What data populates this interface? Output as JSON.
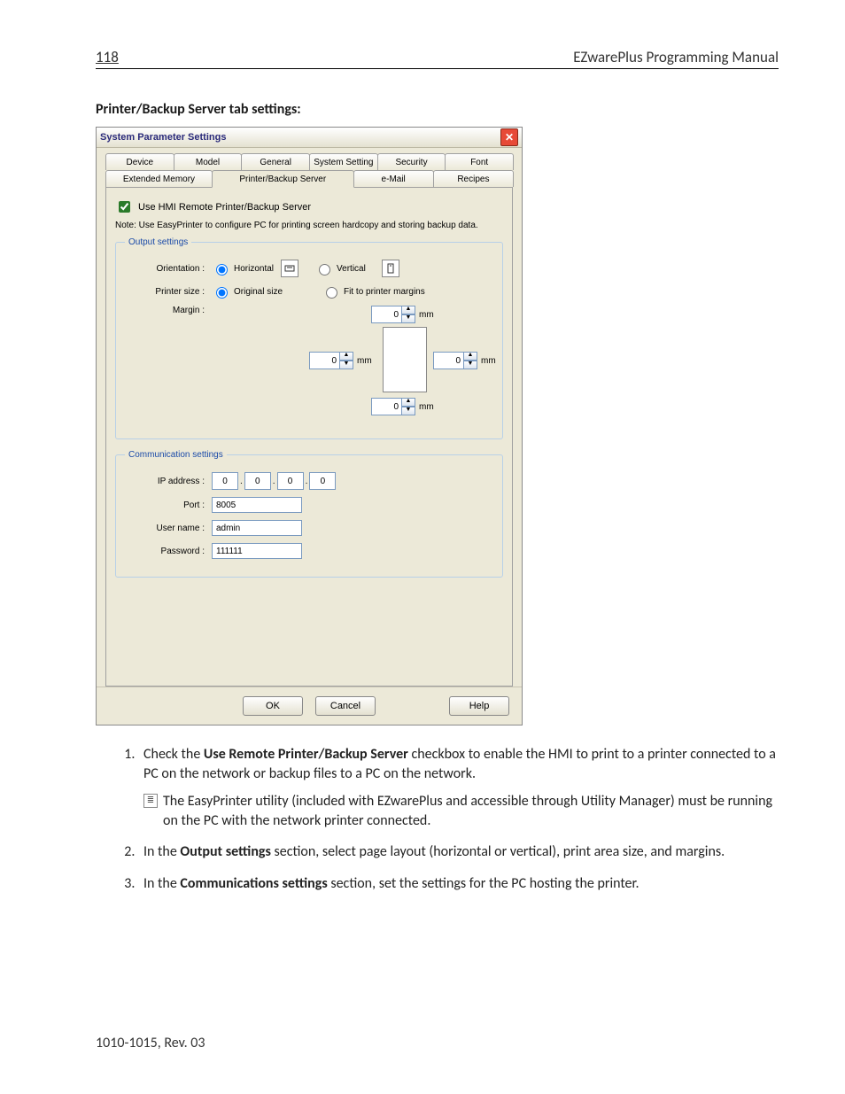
{
  "header": {
    "page_number": "118",
    "doc_title": "EZwarePlus Programming Manual"
  },
  "section_title": "Printer/Backup Server tab settings:",
  "dialog": {
    "title": "System Parameter Settings",
    "tabs_row1": [
      "Device",
      "Model",
      "General",
      "System Setting",
      "Security",
      "Font"
    ],
    "tabs_row2": [
      "Extended Memory",
      "Printer/Backup Server",
      "e-Mail",
      "Recipes"
    ],
    "active_tab": "Printer/Backup Server",
    "checkbox_label": "Use HMI Remote Printer/Backup Server",
    "note_text": "Note: Use EasyPrinter to configure PC for printing screen hardcopy and storing backup data.",
    "output_legend": "Output settings",
    "orientation_label": "Orientation :",
    "orientation_horizontal": "Horizontal",
    "orientation_vertical": "Vertical",
    "printer_size_label": "Printer size :",
    "printer_size_original": "Original size",
    "printer_size_fit": "Fit to printer margins",
    "margin_label": "Margin :",
    "margin_top": "0",
    "margin_left": "0",
    "margin_right": "0",
    "margin_bottom": "0",
    "unit_mm": "mm",
    "comm_legend": "Communication settings",
    "ip_label": "IP address :",
    "ip": [
      "0",
      "0",
      "0",
      "0"
    ],
    "port_label": "Port :",
    "port_value": "8005",
    "user_label": "User name :",
    "user_value": "admin",
    "pass_label": "Password :",
    "pass_value": "111111",
    "btn_ok": "OK",
    "btn_cancel": "Cancel",
    "btn_help": "Help"
  },
  "instructions": {
    "item1_pre": "Check the ",
    "item1_bold": "Use Remote Printer/Backup Server",
    "item1_post": " checkbox to enable the HMI to print to a printer connected to a PC on the network or backup files to a PC on the network.",
    "item1_note": "The EasyPrinter utility (included with EZwarePlus and accessible through Utility Manager) must be running on the PC with the network printer connected.",
    "item2_pre": "In the ",
    "item2_bold": "Output settings",
    "item2_post": " section, select page layout (horizontal or vertical), print area size, and margins.",
    "item3_pre": "In the ",
    "item3_bold": "Communications settings",
    "item3_post": " section, set the settings for the PC hosting the printer."
  },
  "footer": "1010-1015, Rev. 03"
}
